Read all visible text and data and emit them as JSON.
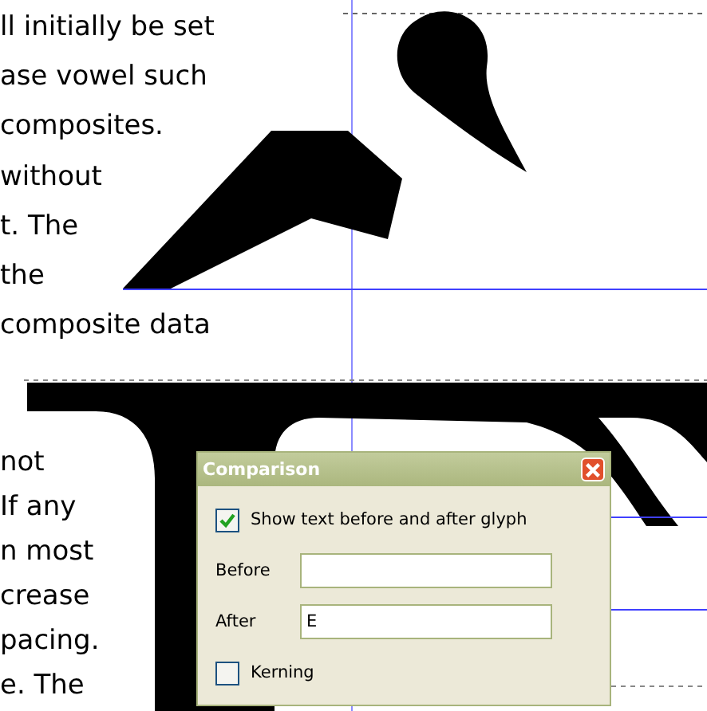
{
  "document": {
    "lines_top": [
      "ll initially be set",
      "ase vowel such",
      "composites.",
      "without",
      "t. The",
      "the",
      "composite data"
    ],
    "lines_bottom": [
      "not",
      "If any",
      "n most",
      "crease",
      "pacing.",
      "e. The"
    ]
  },
  "comparison_dialog": {
    "title": "Comparison",
    "options": [
      {
        "kind": "checkbox",
        "label": "Show text before and after glyph",
        "checked": true
      },
      {
        "kind": "field",
        "label": "Before"
      },
      {
        "kind": "field",
        "label": "After",
        "value": "E"
      },
      {
        "kind": "checkbox",
        "label": "Kerning",
        "checked": false
      }
    ]
  }
}
